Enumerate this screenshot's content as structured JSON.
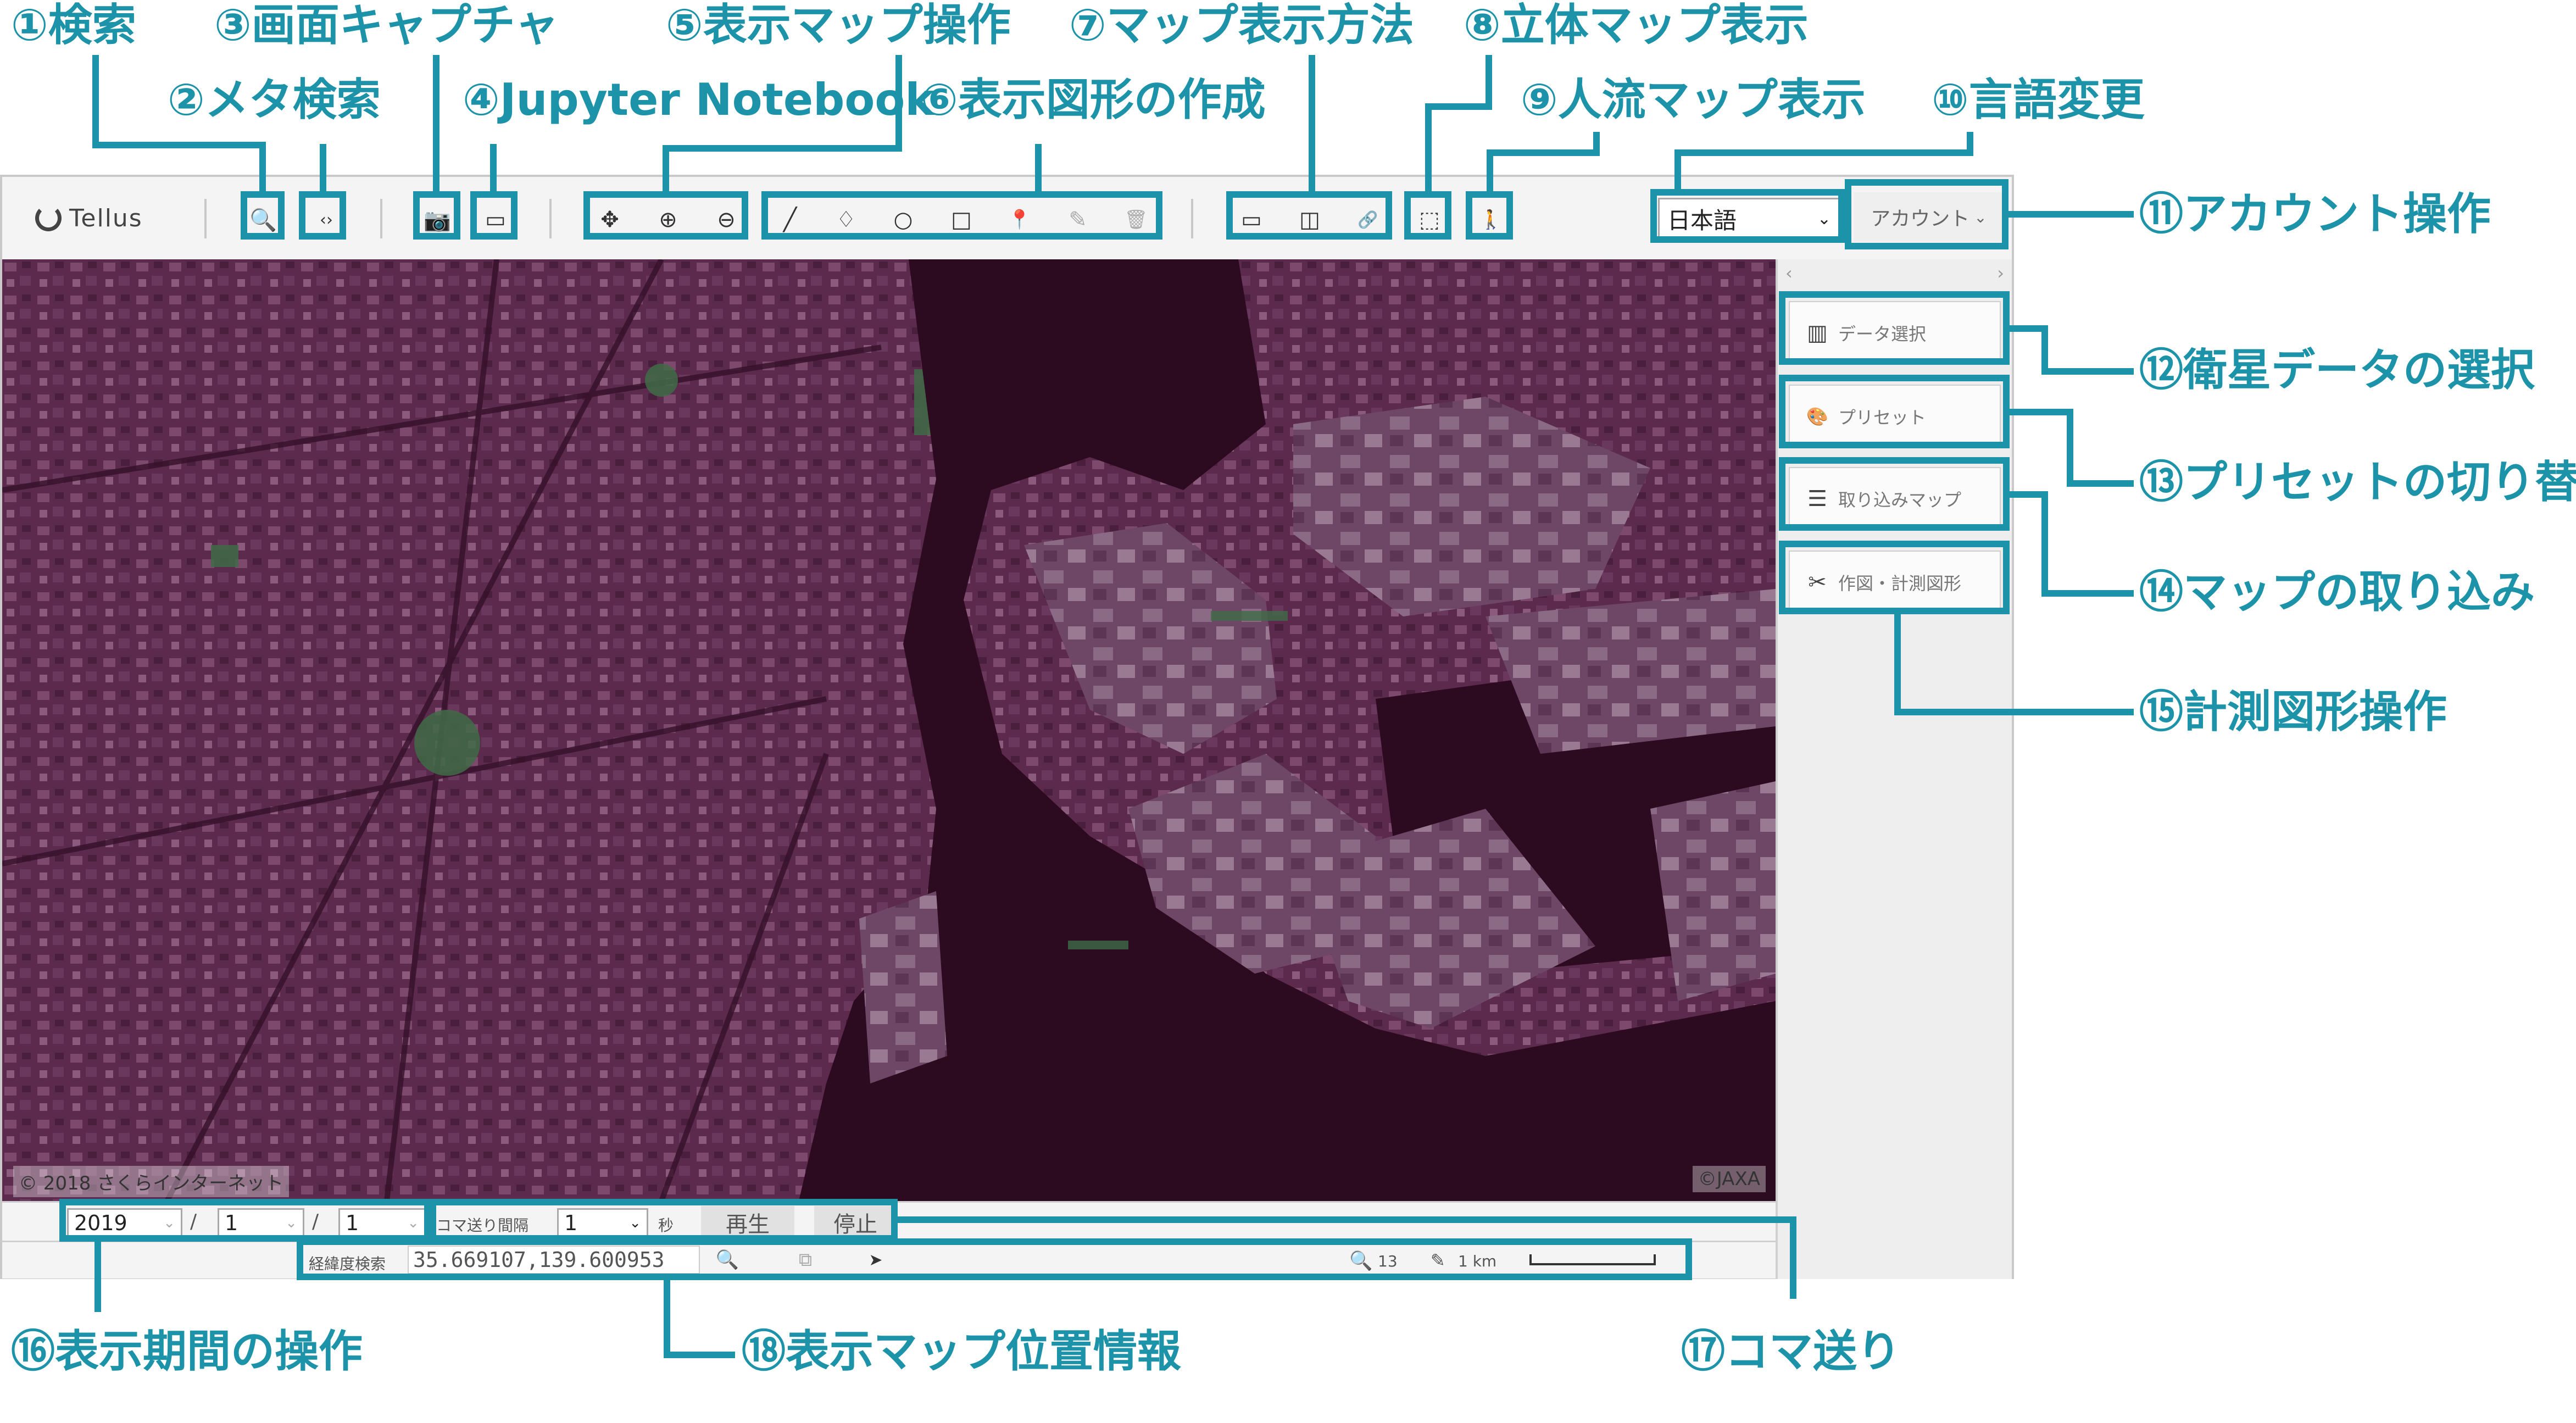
{
  "annotations": {
    "search": "①検索",
    "meta_search": "②メタ検索",
    "capture": "③画面キャプチャ",
    "jupyter": "④Jupyter Notebook",
    "map_ops": "⑤表示マップ操作",
    "shapes": "⑥表示図形の作成",
    "display_mode": "⑦マップ表示方法",
    "map_3d": "⑧立体マップ表示",
    "people_flow": "⑨人流マップ表示",
    "language": "⑩言語変更",
    "account": "⑪アカウント操作",
    "satellite_data": "⑫衛星データの選択",
    "preset": "⑬プリセットの切り替え",
    "import_map": "⑭マップの取り込み",
    "measure": "⑮計測図形操作",
    "period": "⑯表示期間の操作",
    "frame_step": "⑰コマ送り",
    "position_info": "⑱表示マップ位置情報"
  },
  "toolbar": {
    "logo_text": "Tellus",
    "language": "日本語",
    "account": "アカウント",
    "icons": {
      "search": "🔍",
      "meta": "‹›",
      "camera": "📷",
      "notebook": "▭",
      "move": "✥",
      "zoom_in": "⊕",
      "zoom_out": "⊖",
      "line": "╱",
      "lasso": "♢",
      "circle": "○",
      "rect": "□",
      "pin": "📍",
      "edit": "✎",
      "trash": "🗑",
      "single": "▭",
      "split": "◫",
      "link": "🔗",
      "cube": "⬚",
      "walker": "🚶"
    }
  },
  "panel": {
    "buttons": [
      {
        "label": "データ選択",
        "icon": "▥"
      },
      {
        "label": "プリセット",
        "icon": "🎨"
      },
      {
        "label": "取り込みマップ",
        "icon": "☰"
      },
      {
        "label": "作図・計測図形",
        "icon": "✂"
      }
    ]
  },
  "map": {
    "credit_left": "© 2018 さくらインターネット",
    "credit_right": "©JAXA"
  },
  "timebar": {
    "year": "2019",
    "month": "1",
    "day": "1",
    "slash": "/",
    "interval_label": "コマ送り間隔",
    "interval": "1",
    "seconds": "秒",
    "play": "再生",
    "stop": "停止"
  },
  "coordbar": {
    "label": "経緯度検索",
    "coords": "35.669107,139.600953",
    "zoom": "13",
    "scale": "1 km"
  },
  "colors": {
    "accent": "#1c93a8",
    "map_base": "#3a1129",
    "water": "#2c0a1f",
    "land": "#6e3c60"
  }
}
